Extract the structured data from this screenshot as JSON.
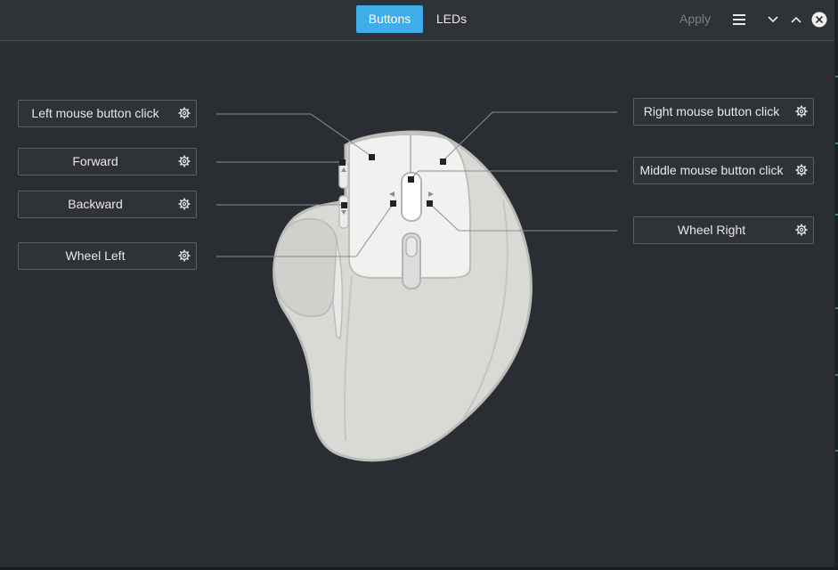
{
  "header": {
    "tabs": [
      {
        "label": "Buttons",
        "active": true
      },
      {
        "label": "LEDs",
        "active": false
      }
    ],
    "apply_label": "Apply",
    "icons": [
      "hamburger-menu-icon",
      "minimize-chevron-icon",
      "maximize-chevron-icon",
      "close-circle-icon"
    ]
  },
  "buttons": {
    "left_click": "Left mouse button click",
    "forward": "Forward",
    "backward": "Backward",
    "wheel_left": "Wheel Left",
    "right_click": "Right mouse button click",
    "middle_click": "Middle mouse button click",
    "wheel_right": "Wheel Right"
  },
  "colors": {
    "accent": "#3daee9",
    "background": "#2a2d32",
    "mouse_body": "#d9d9d6",
    "mouse_outline": "#bdbdba"
  }
}
